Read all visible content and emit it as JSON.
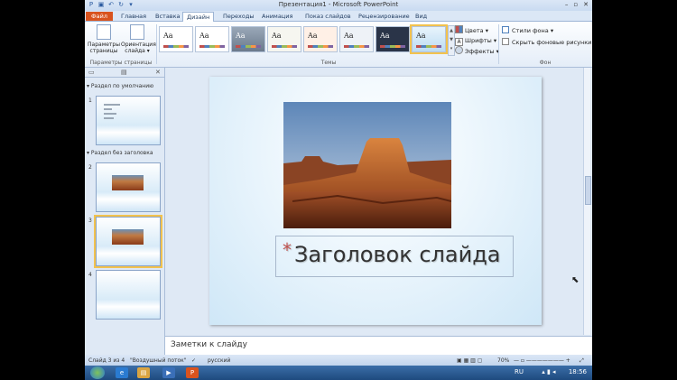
{
  "window": {
    "title": "Презентация1 - Microsoft PowerPoint",
    "controls": [
      "–",
      "▫",
      "✕"
    ]
  },
  "ribbon": {
    "tabs": [
      "Файл",
      "Главная",
      "Вставка",
      "Дизайн",
      "Переходы",
      "Анимация",
      "Показ слайдов",
      "Рецензирование",
      "Вид"
    ],
    "active_tab": "Дизайн",
    "page_setup": {
      "page_params": "Параметры страницы",
      "orientation": "Ориентация слайда ▾",
      "group_label": "Параметры страницы"
    },
    "themes": {
      "sample": "Aa",
      "group_label": "Темы",
      "options": [
        "Цвета ▾",
        "Шрифты ▾",
        "Эффекты ▾"
      ]
    },
    "background": {
      "styles": "Стили фона ▾",
      "hide_graphics": "Скрыть фоновые рисунки",
      "group_label": "Фон"
    }
  },
  "slides_panel": {
    "sections": [
      "Раздел по умолчанию",
      "Раздел без заголовка"
    ],
    "slide_numbers": [
      "1",
      "2",
      "3",
      "4"
    ],
    "selected": "3"
  },
  "slide": {
    "title": "Заголовок слайда",
    "asterisk": "*"
  },
  "notes": {
    "placeholder": "Заметки к слайду"
  },
  "status": {
    "slide_info": "Слайд 3 из 4",
    "theme": "\"Воздушный поток\"",
    "language": "русский",
    "zoom": "70%"
  },
  "taskbar": {
    "lang": "RU",
    "time": "18:56"
  }
}
